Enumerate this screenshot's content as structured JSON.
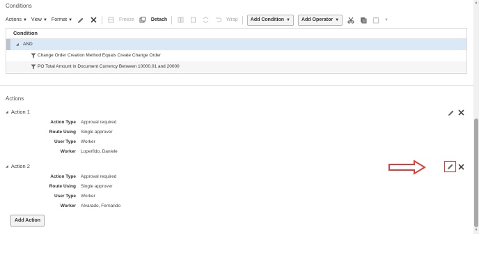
{
  "conditions_section": {
    "title": "Conditions",
    "toolbar": {
      "actions_menu": "Actions",
      "view_menu": "View",
      "format_menu": "Format",
      "freeze": "Freeze",
      "detach": "Detach",
      "wrap": "Wrap",
      "add_condition": "Add Condition",
      "add_operator": "Add Operator"
    },
    "table": {
      "column_header": "Condition",
      "operator": "AND",
      "rows": [
        "Change Order Creation Method Equals Create Change Order",
        "PO Total Amount in Document Currency Between 10000.01 and 20000"
      ]
    }
  },
  "actions_section": {
    "title": "Actions",
    "labels": {
      "action_type": "Action Type",
      "route_using": "Route Using",
      "user_type": "User Type",
      "worker": "Worker"
    },
    "actions": [
      {
        "name": "Action 1",
        "action_type": "Approval required",
        "route_using": "Single approver",
        "user_type": "Worker",
        "worker": "Loperfido, Daniele"
      },
      {
        "name": "Action 2",
        "action_type": "Approval required",
        "route_using": "Single approver",
        "user_type": "Worker",
        "worker": "Alvarado, Fernando"
      }
    ],
    "add_action_label": "Add Action"
  },
  "colors": {
    "selected_row": "#dbe8f5",
    "annotation_red": "#e53935",
    "icon_gray": "#555555"
  },
  "icons": {
    "edit": "pencil-icon",
    "delete": "close-icon",
    "filter": "filter-icon",
    "annotation": "red-arrow-icon"
  }
}
